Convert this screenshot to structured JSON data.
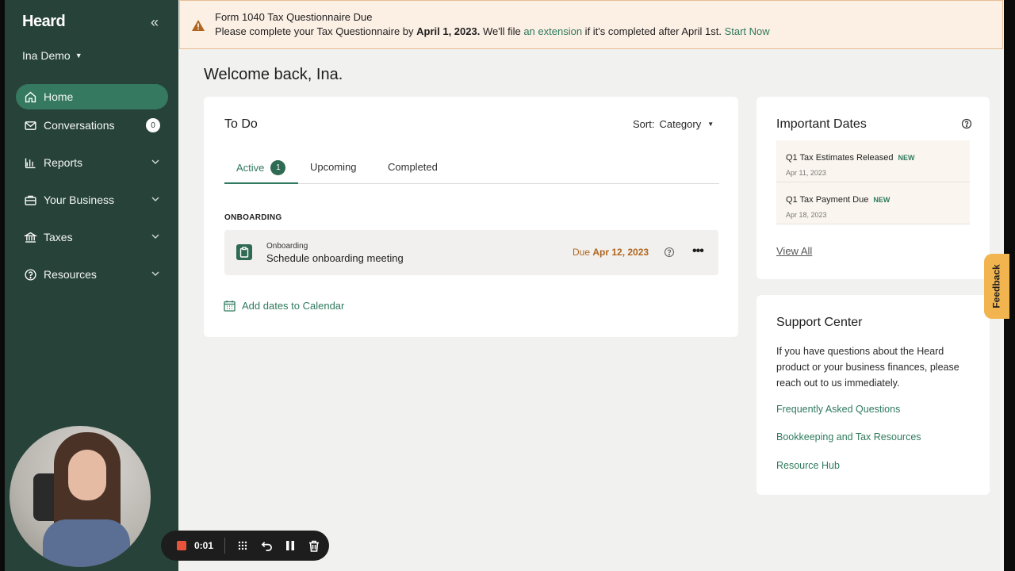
{
  "sidebar": {
    "logo": "Heard",
    "collapse_icon": "«",
    "user_name": "Ina Demo",
    "items": [
      {
        "label": "Home",
        "icon": "home-icon"
      },
      {
        "label": "Conversations",
        "icon": "mail-icon",
        "badge": "0"
      },
      {
        "label": "Reports",
        "icon": "bar-chart-icon"
      },
      {
        "label": "Your Business",
        "icon": "briefcase-icon"
      },
      {
        "label": "Taxes",
        "icon": "bank-icon"
      },
      {
        "label": "Resources",
        "icon": "help-circle-icon"
      }
    ]
  },
  "recorder": {
    "time": "0:01"
  },
  "banner": {
    "title": "Form 1040 Tax Questionnaire Due",
    "msg_part1": "Please complete your Tax Questionnaire by ",
    "msg_date": "April 1, 2023.",
    "msg_part2": " We'll file ",
    "msg_link": "an extension",
    "msg_part3": " if it's completed after April 1st. ",
    "msg_cta": "Start Now"
  },
  "welcome": "Welcome back, Ina.",
  "todo": {
    "title": "To Do",
    "sort_label": "Sort:",
    "sort_value": "Category",
    "tabs": [
      {
        "label": "Active",
        "count": "1"
      },
      {
        "label": "Upcoming"
      },
      {
        "label": "Completed"
      }
    ],
    "section_label": "ONBOARDING",
    "task": {
      "category": "Onboarding",
      "name": "Schedule onboarding meeting",
      "due_label": "Due",
      "due_date": "Apr 12, 2023",
      "more": "•••"
    },
    "calendar_link": "Add dates to Calendar"
  },
  "important_dates": {
    "title": "Important Dates",
    "items": [
      {
        "name": "Q1 Tax Estimates Released",
        "tag": "NEW",
        "date": "Apr 11, 2023"
      },
      {
        "name": "Q1 Tax Payment Due",
        "tag": "NEW",
        "date": "Apr 18, 2023"
      }
    ],
    "view_all": "View All"
  },
  "support": {
    "title": "Support Center",
    "text": "If you have questions about the Heard product or your business finances, please reach out to us immediately.",
    "links": [
      "Frequently Asked Questions",
      "Bookkeeping and Tax Resources",
      "Resource Hub"
    ]
  },
  "feedback": "Feedback",
  "colors": {
    "sidebar": "#274239",
    "accent": "#2f7a5e",
    "warning": "#b0651e",
    "feedback": "#f2b44f"
  }
}
